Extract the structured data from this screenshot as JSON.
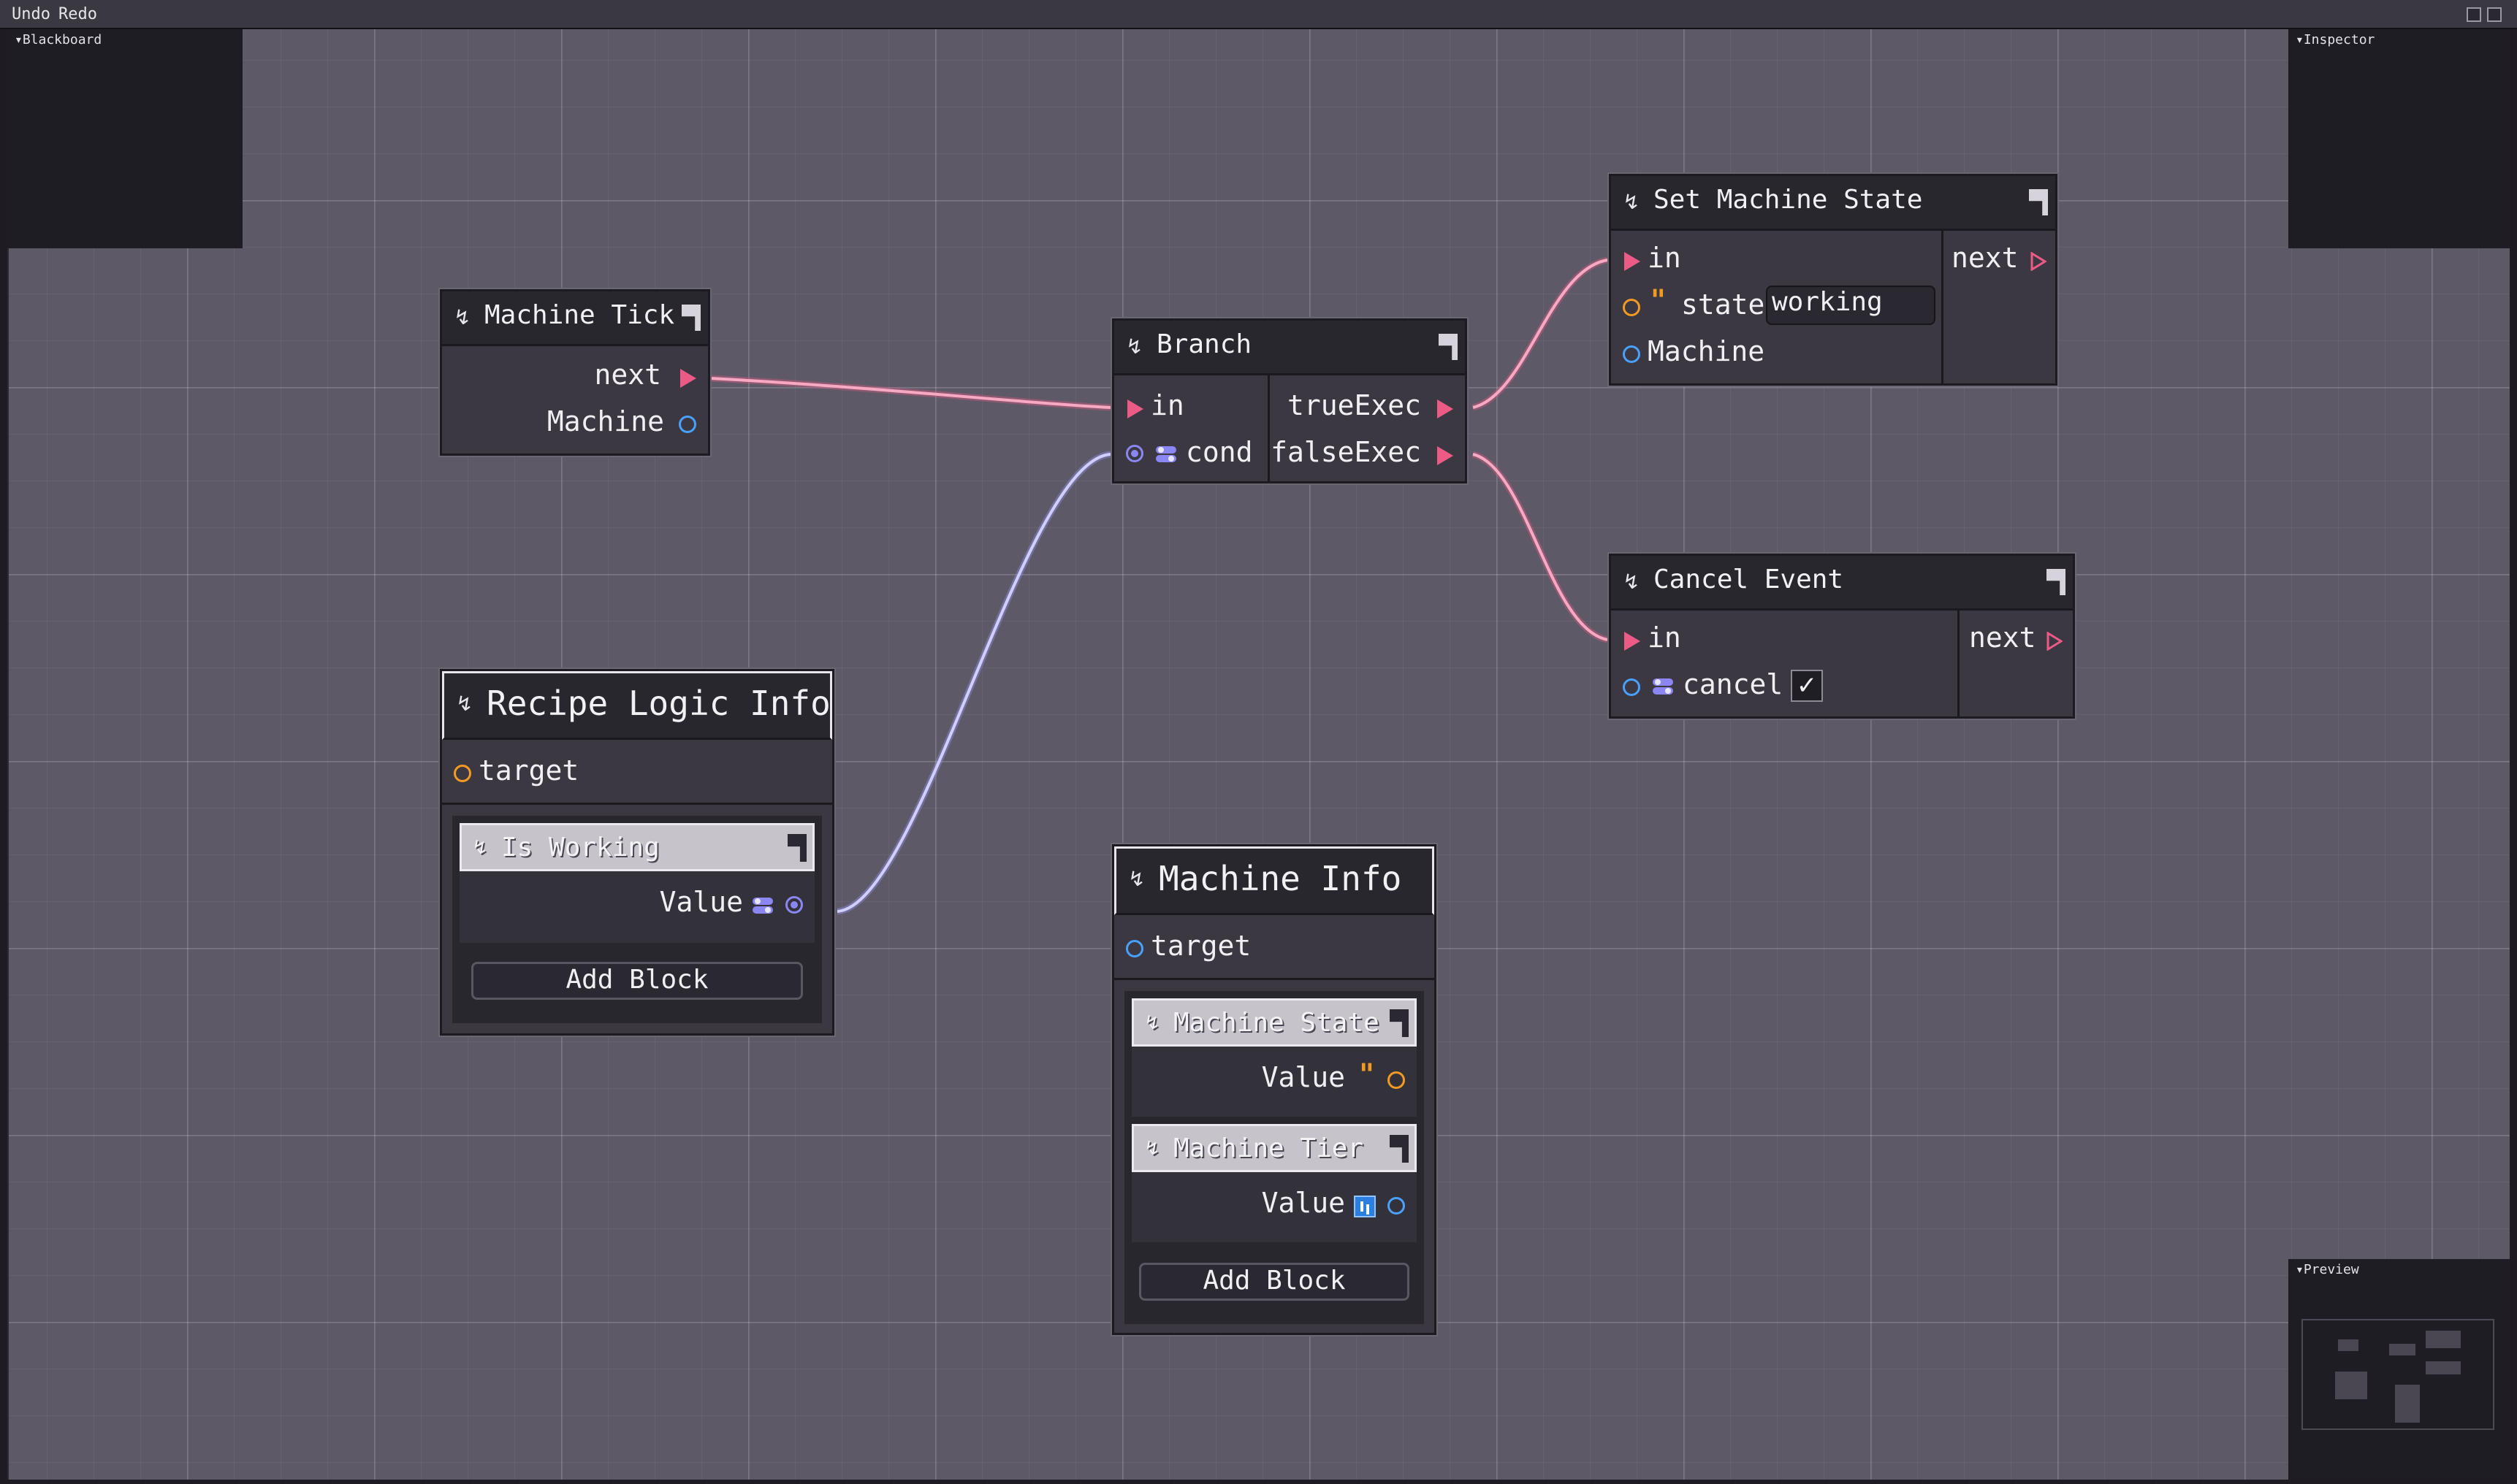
{
  "toolbar": {
    "undo": "Undo",
    "redo": "Redo"
  },
  "panels": {
    "blackboard": "▾Blackboard",
    "inspector": "▾Inspector",
    "preview": "▾Preview"
  },
  "nodes": {
    "machine_tick": {
      "title": "Machine Tick",
      "outputs": [
        "next",
        "Machine"
      ]
    },
    "branch": {
      "title": "Branch",
      "inputs": [
        "in",
        "cond"
      ],
      "outputs": [
        "trueExec",
        "falseExec"
      ]
    },
    "set_machine_state": {
      "title": "Set Machine State",
      "inputs": [
        "in",
        "state",
        "Machine"
      ],
      "state_value": "working",
      "outputs": [
        "next"
      ]
    },
    "cancel_event": {
      "title": "Cancel Event",
      "inputs": [
        "in",
        "cancel"
      ],
      "cancel_checked": "✓",
      "outputs": [
        "next"
      ]
    },
    "recipe_logic_info": {
      "title": "Recipe Logic Info",
      "input": "target",
      "blocks": [
        {
          "title": "Is Working",
          "output": "Value"
        }
      ],
      "add_block": "Add Block"
    },
    "machine_info": {
      "title": "Machine Info",
      "input": "target",
      "blocks": [
        {
          "title": "Machine State",
          "output": "Value"
        },
        {
          "title": "Machine Tier",
          "output": "Value"
        }
      ],
      "add_block": "Add Block"
    }
  },
  "colors": {
    "exec_wire": "#ec5a86",
    "bool_wire": "#b0acff",
    "string_port": "#f29a24",
    "object_port": "#4aa0ff",
    "bool_port": "#8a86f2"
  }
}
